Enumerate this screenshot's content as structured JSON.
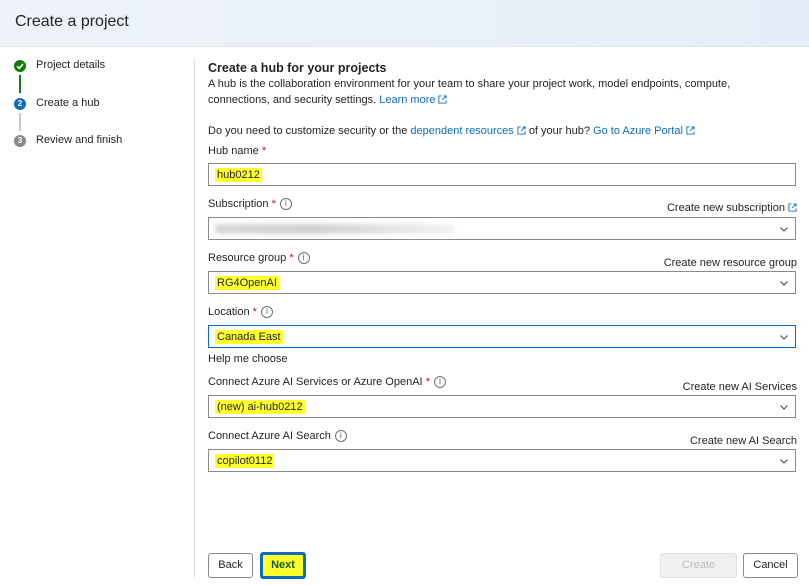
{
  "header": {
    "title": "Create a project"
  },
  "steps": [
    {
      "label": "Project details",
      "state": "completed",
      "icon": "check-icon"
    },
    {
      "label": "Create a hub",
      "state": "current",
      "number": "2"
    },
    {
      "label": "Review and finish",
      "state": "upcoming",
      "number": "3"
    }
  ],
  "form": {
    "title": "Create a hub for your projects",
    "description": "A hub is the collaboration environment for your team to share your project work, model endpoints, compute, connections, and security settings.",
    "learn_more": "Learn more",
    "customize_prefix": "Do you need to customize security or the",
    "dependent_resources": "dependent resources",
    "customize_suffix": "of your hub?",
    "go_to_portal": "Go to Azure Portal",
    "required_mark": "*",
    "hub_name": {
      "label": "Hub name",
      "value": "hub0212"
    },
    "subscription": {
      "label": "Subscription",
      "create_link": "Create new subscription"
    },
    "resource_group": {
      "label": "Resource group",
      "value": "RG4OpenAI",
      "create_link": "Create new resource group"
    },
    "location": {
      "label": "Location",
      "value": "Canada East",
      "help_link": "Help me choose"
    },
    "ai_services": {
      "label": "Connect Azure AI Services or Azure OpenAI",
      "value": "(new) ai-hub0212",
      "create_link": "Create new AI Services"
    },
    "ai_search": {
      "label": "Connect Azure AI Search",
      "value": "copilot0112",
      "create_link": "Create new AI Search"
    }
  },
  "buttons": {
    "back": "Back",
    "next": "Next",
    "create": "Create",
    "cancel": "Cancel"
  },
  "colors": {
    "accent": "#0f6cbd",
    "success": "#107c10",
    "required": "#c50f1f",
    "highlight": "#ffff2e",
    "muted_step": "#8a8a8a"
  }
}
